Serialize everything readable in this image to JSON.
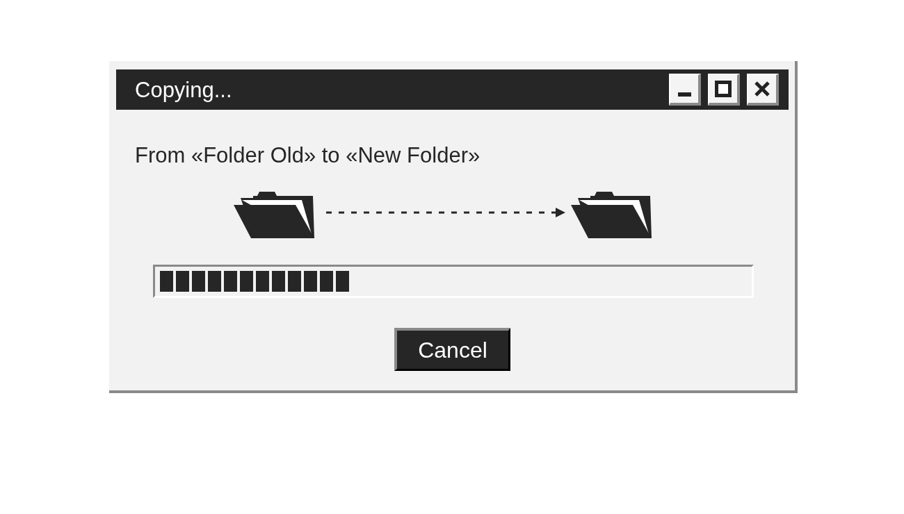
{
  "window": {
    "title": "Copying...",
    "controls": [
      {
        "kind": "minimize"
      },
      {
        "kind": "maximize"
      },
      {
        "kind": "close"
      }
    ]
  },
  "message": "From «Folder Old» to «New Folder»",
  "progress": {
    "level": 0.325
  },
  "buttons": [
    "Cancel"
  ]
}
